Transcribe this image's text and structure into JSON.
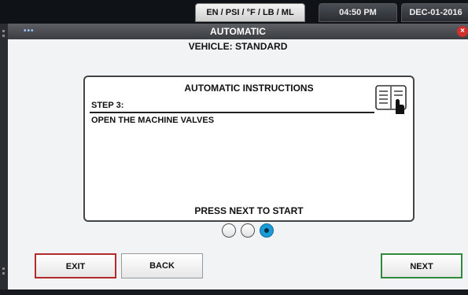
{
  "status": {
    "units": "EN / PSI / °F / LB / ML",
    "time": "04:50 PM",
    "date": "DEC-01-2016"
  },
  "window": {
    "title": "AUTOMATIC",
    "dots": "•••",
    "close_glyph": "×",
    "subtitle": "VEHICLE: STANDARD"
  },
  "panel": {
    "title": "AUTOMATIC INSTRUCTIONS",
    "step_label": "STEP 3:",
    "step_text": "OPEN THE MACHINE VALVES",
    "footer": "PRESS NEXT TO START",
    "icon": "manual-book-icon"
  },
  "pager": {
    "current": 3,
    "total": 3
  },
  "buttons": {
    "exit": "EXIT",
    "back": "BACK",
    "next": "NEXT"
  },
  "colors": {
    "exit_border": "#b22a2a",
    "next_border": "#2f8a3c",
    "active_dot": "#1b9ad8",
    "close": "#d0302c"
  }
}
